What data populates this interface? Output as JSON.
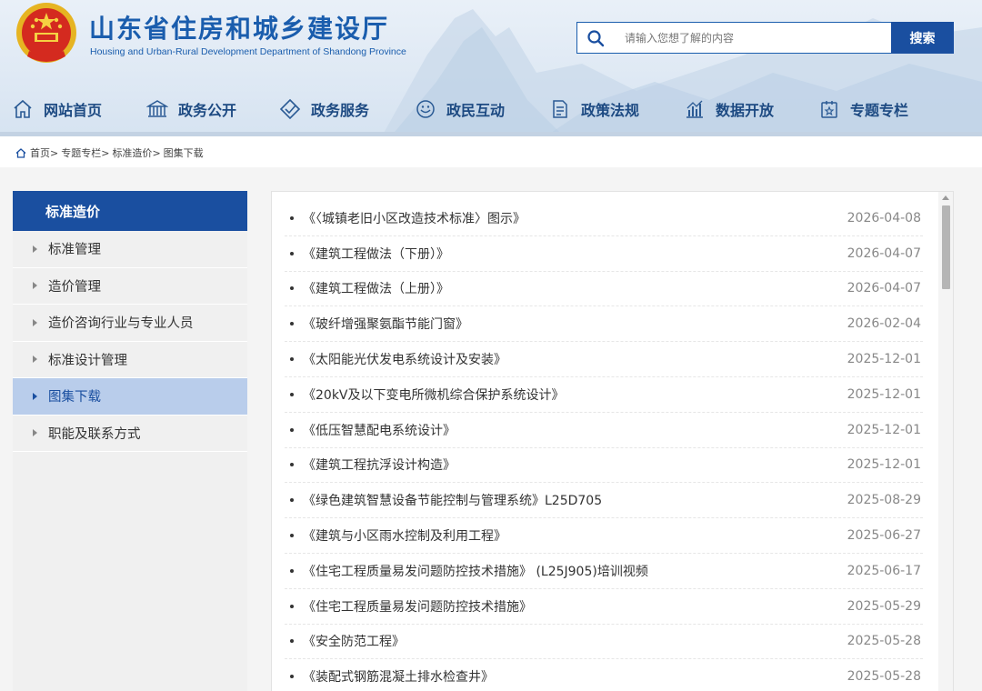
{
  "header": {
    "title": "山东省住房和城乡建设厅",
    "subtitle": "Housing and Urban-Rural Development Department of Shandong Province",
    "search_placeholder": "请输入您想了解的内容",
    "search_button": "搜索",
    "brand_color": "#1a4fa0"
  },
  "nav": {
    "items": [
      {
        "label": "网站首页",
        "icon": "home-icon"
      },
      {
        "label": "政务公开",
        "icon": "building-icon"
      },
      {
        "label": "政务服务",
        "icon": "service-icon"
      },
      {
        "label": "政民互动",
        "icon": "interaction-icon"
      },
      {
        "label": "政策法规",
        "icon": "document-icon"
      },
      {
        "label": "数据开放",
        "icon": "chart-icon"
      },
      {
        "label": "专题专栏",
        "icon": "topic-icon"
      }
    ]
  },
  "breadcrumb": {
    "items": [
      "首页",
      "专题专栏",
      "标准造价",
      "图集下载"
    ],
    "separator": ">"
  },
  "sidebar": {
    "title": "标准造价",
    "items": [
      {
        "label": "标准管理",
        "active": false
      },
      {
        "label": "造价管理",
        "active": false
      },
      {
        "label": "造价咨询行业与专业人员",
        "active": false
      },
      {
        "label": "标准设计管理",
        "active": false
      },
      {
        "label": "图集下载",
        "active": true
      },
      {
        "label": "职能及联系方式",
        "active": false
      }
    ]
  },
  "list": {
    "items": [
      {
        "title": "《〈城镇老旧小区改造技术标准〉图示》",
        "date": "2026-04-08"
      },
      {
        "title": "《建筑工程做法（下册）》",
        "date": "2026-04-07"
      },
      {
        "title": "《建筑工程做法（上册）》",
        "date": "2026-04-07"
      },
      {
        "title": "《玻纤增强聚氨酯节能门窗》",
        "date": "2026-02-04"
      },
      {
        "title": "《太阳能光伏发电系统设计及安装》",
        "date": "2025-12-01"
      },
      {
        "title": "《20kV及以下变电所微机综合保护系统设计》",
        "date": "2025-12-01"
      },
      {
        "title": "《低压智慧配电系统设计》",
        "date": "2025-12-01"
      },
      {
        "title": "《建筑工程抗浮设计构造》",
        "date": "2025-12-01"
      },
      {
        "title": "《绿色建筑智慧设备节能控制与管理系统》L25D705",
        "date": "2025-08-29"
      },
      {
        "title": "《建筑与小区雨水控制及利用工程》",
        "date": "2025-06-27"
      },
      {
        "title": "《住宅工程质量易发问题防控技术措施》 (L25J905)培训视频",
        "date": "2025-06-17"
      },
      {
        "title": "《住宅工程质量易发问题防控技术措施》",
        "date": "2025-05-29"
      },
      {
        "title": "《安全防范工程》",
        "date": "2025-05-28"
      },
      {
        "title": "《装配式钢筋混凝土排水检查井》",
        "date": "2025-05-28"
      }
    ]
  }
}
